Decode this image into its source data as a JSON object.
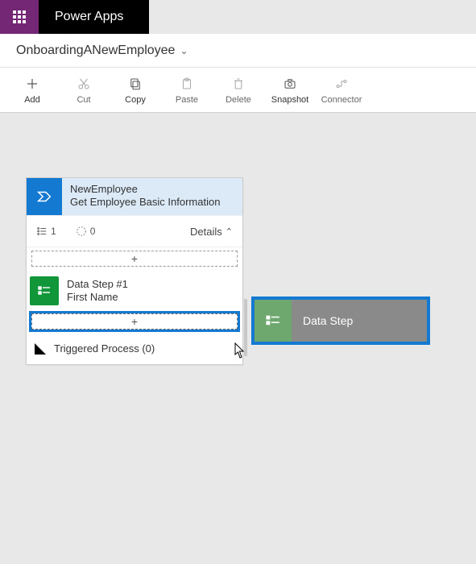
{
  "header": {
    "app_title": "Power Apps"
  },
  "breadcrumb": {
    "flow_name": "OnboardingANewEmployee"
  },
  "toolbar": {
    "add": {
      "label": "Add"
    },
    "cut": {
      "label": "Cut"
    },
    "copy": {
      "label": "Copy"
    },
    "paste": {
      "label": "Paste"
    },
    "delete": {
      "label": "Delete"
    },
    "snapshot": {
      "label": "Snapshot"
    },
    "connector": {
      "label": "Connector"
    }
  },
  "step_card": {
    "title": "NewEmployee",
    "subtitle": "Get Employee Basic Information",
    "stat_steps": "1",
    "stat_pending": "0",
    "details_label": "Details",
    "insert_plus_top": "+",
    "data_step_title": "Data Step #1",
    "data_step_sub": "First Name",
    "insert_plus_sel": "+",
    "triggered_label": "Triggered Process (0)"
  },
  "drag_tile": {
    "label": "Data Step"
  }
}
